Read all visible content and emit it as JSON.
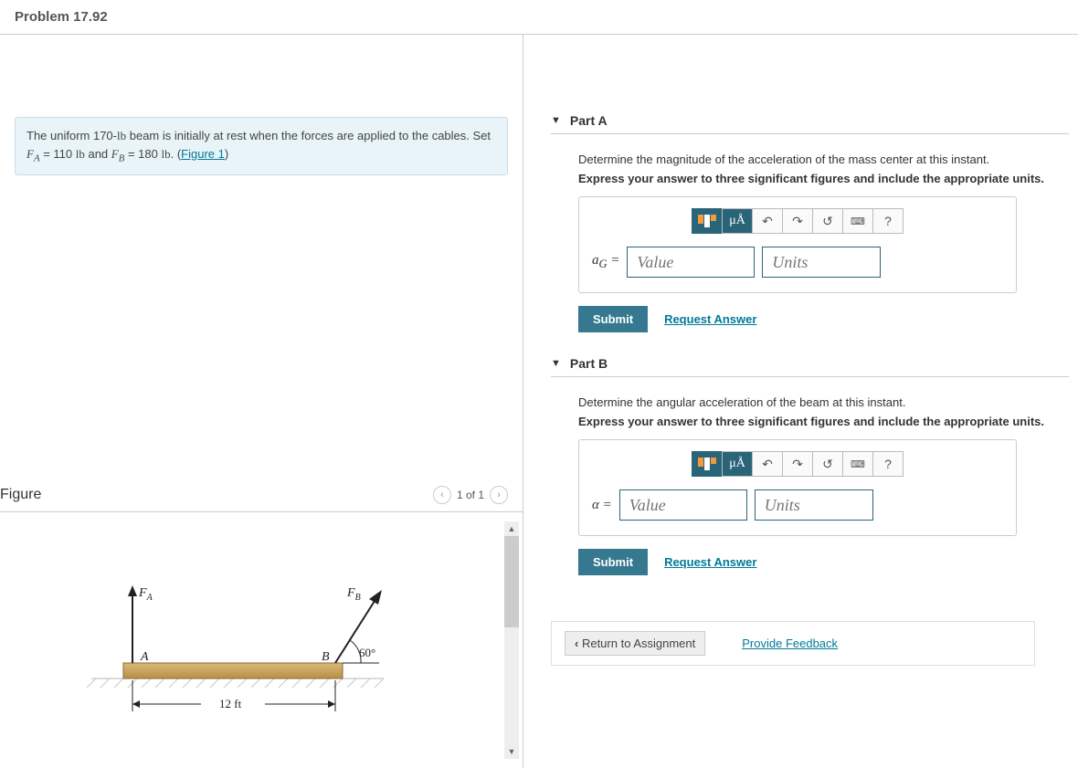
{
  "header": {
    "title": "Problem 17.92"
  },
  "problem": {
    "text_before": "The uniform 170-",
    "lb1": "lb",
    "text_mid1": " beam is initially at rest when the forces are applied to the cables. Set ",
    "fa_sym": "F",
    "fa_sub": "A",
    "eq1": " = 110 ",
    "lb2": "lb",
    "and": " and ",
    "fb_sym": "F",
    "fb_sub": "B",
    "eq2": " = 180 ",
    "lb3": "lb",
    "period": ". (",
    "fig_link": "Figure 1",
    "close": ")"
  },
  "figure": {
    "title": "Figure",
    "pager": "1 of 1",
    "label_FA_F": "F",
    "label_FA_A": "A",
    "label_FB_F": "F",
    "label_FB_B": "B",
    "label_A": "A",
    "label_B": "B",
    "angle": "60°",
    "dim": "12 ft"
  },
  "parts": {
    "a": {
      "title": "Part A",
      "instr1": "Determine the magnitude of the acceleration of the mass center at this instant.",
      "instr2": "Express your answer to three significant figures and include the appropriate units.",
      "var_sym": "a",
      "var_sub": "G",
      "equals": " = ",
      "value_ph": "Value",
      "units_ph": "Units",
      "mu_label": "μÅ",
      "help": "?",
      "submit": "Submit",
      "req": "Request Answer"
    },
    "b": {
      "title": "Part B",
      "instr1": "Determine the angular acceleration of the beam at this instant.",
      "instr2": "Express your answer to three significant figures and include the appropriate units.",
      "var_sym": "α",
      "equals": " = ",
      "value_ph": "Value",
      "units_ph": "Units",
      "mu_label": "μÅ",
      "help": "?",
      "submit": "Submit",
      "req": "Request Answer"
    }
  },
  "footer": {
    "return": "Return to Assignment",
    "feedback": "Provide Feedback"
  }
}
